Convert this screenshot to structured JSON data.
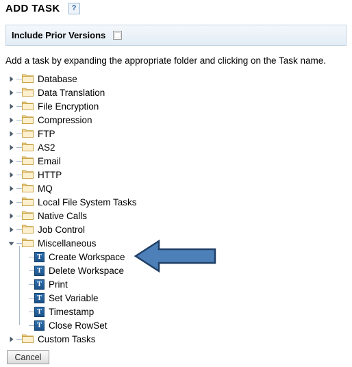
{
  "header": {
    "title": "ADD TASK",
    "help_label": "?",
    "help_icon": "question-mark-icon"
  },
  "prior_versions": {
    "label": "Include Prior Versions",
    "checked": false
  },
  "instruction": "Add a task by expanding the appropriate folder and clicking on the Task name.",
  "tree": {
    "folder_icon": "folder-icon",
    "task_icon": "task-icon",
    "task_icon_glyph": "T",
    "collapsed_icon": "chevron-right-icon",
    "expanded_icon": "chevron-down-icon",
    "nodes": [
      {
        "label": "Database",
        "type": "folder",
        "expanded": false
      },
      {
        "label": "Data Translation",
        "type": "folder",
        "expanded": false
      },
      {
        "label": "File Encryption",
        "type": "folder",
        "expanded": false
      },
      {
        "label": "Compression",
        "type": "folder",
        "expanded": false
      },
      {
        "label": "FTP",
        "type": "folder",
        "expanded": false
      },
      {
        "label": "AS2",
        "type": "folder",
        "expanded": false
      },
      {
        "label": "Email",
        "type": "folder",
        "expanded": false
      },
      {
        "label": "HTTP",
        "type": "folder",
        "expanded": false
      },
      {
        "label": "MQ",
        "type": "folder",
        "expanded": false
      },
      {
        "label": "Local File System Tasks",
        "type": "folder",
        "expanded": false
      },
      {
        "label": "Native Calls",
        "type": "folder",
        "expanded": false
      },
      {
        "label": "Job Control",
        "type": "folder",
        "expanded": false
      },
      {
        "label": "Miscellaneous",
        "type": "folder",
        "expanded": true,
        "children": [
          {
            "label": "Create Workspace",
            "type": "task"
          },
          {
            "label": "Delete Workspace",
            "type": "task"
          },
          {
            "label": "Print",
            "type": "task"
          },
          {
            "label": "Set Variable",
            "type": "task"
          },
          {
            "label": "Timestamp",
            "type": "task"
          },
          {
            "label": "Close RowSet",
            "type": "task"
          }
        ]
      },
      {
        "label": "Custom Tasks",
        "type": "folder",
        "expanded": false
      }
    ]
  },
  "annotation": {
    "arrow_icon": "left-arrow-annotation",
    "points_to": "Create Workspace",
    "fill_color": "#4d7fb8",
    "stroke_color": "#1f3f66"
  },
  "footer": {
    "cancel_label": "Cancel"
  },
  "colors": {
    "background": "#ffffff",
    "bar_background": "#eaf1f8",
    "bar_border": "#c3d3e2",
    "folder_fill": "#f6dfa8",
    "folder_border": "#c9a449",
    "task_icon_blue": "#1d5288",
    "tree_line": "#a8bacb",
    "text": "#000000"
  }
}
